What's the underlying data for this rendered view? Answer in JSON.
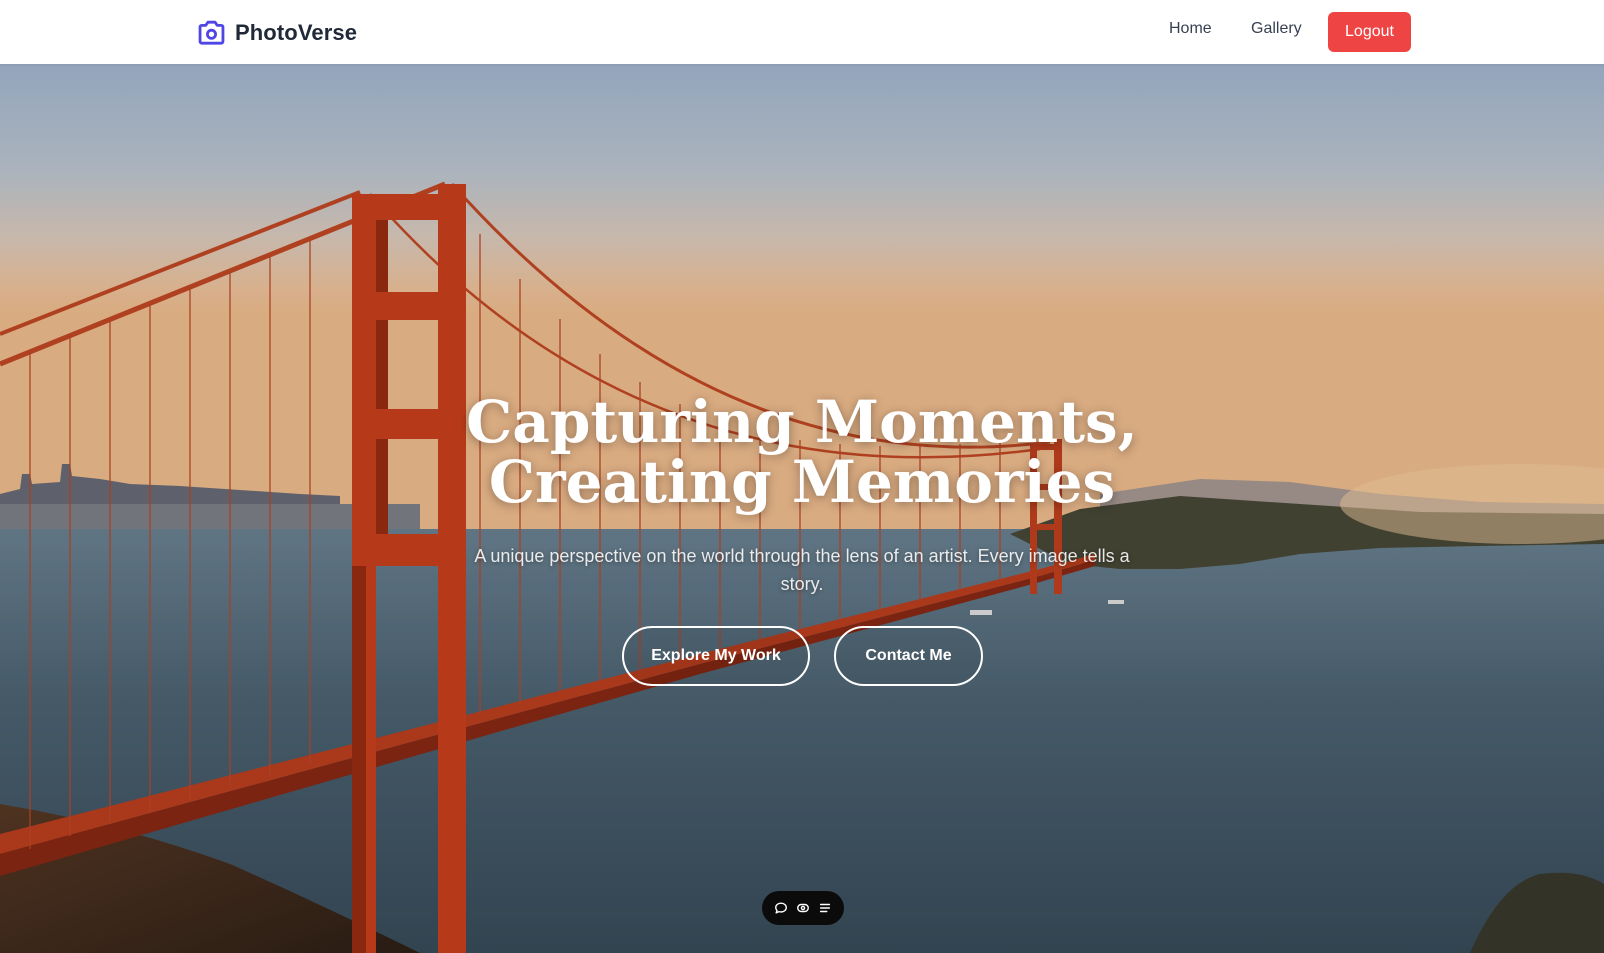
{
  "brand": {
    "name": "PhotoVerse",
    "icon": "camera-icon",
    "accent": "#4f46e5"
  },
  "nav": {
    "home": "Home",
    "gallery": "Gallery",
    "logout": "Logout",
    "logout_color": "#ef4444"
  },
  "hero": {
    "image": "golden-gate-bridge-photo",
    "title_line1": "Capturing Moments,",
    "title_line2": "Creating Memories",
    "subtitle": "A unique perspective on the world through the lens of an artist. Every image tells a story.",
    "buttons": {
      "explore": "Explore My Work",
      "contact": "Contact Me"
    }
  },
  "floating_toolbar": {
    "icons": [
      "comment-icon",
      "eye-icon",
      "menu-icon"
    ]
  }
}
